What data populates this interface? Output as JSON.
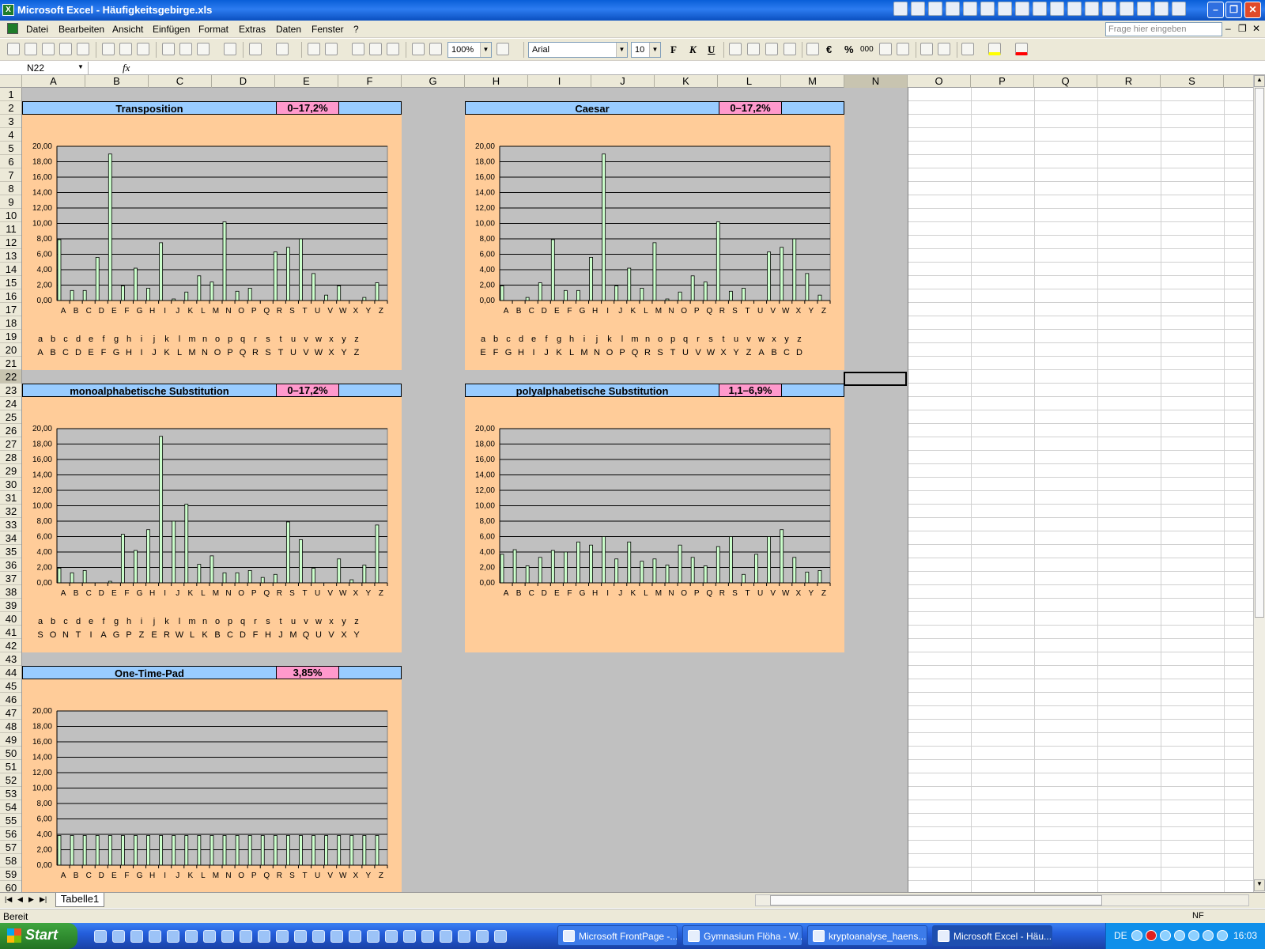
{
  "window": {
    "title": "Microsoft Excel - Häufigkeitsgebirge.xls"
  },
  "menu": [
    "Datei",
    "Bearbeiten",
    "Ansicht",
    "Einfügen",
    "Format",
    "Extras",
    "Daten",
    "Fenster",
    "?"
  ],
  "help_placeholder": "Frage hier eingeben",
  "toolbar": {
    "zoom": "100%",
    "font": "Arial",
    "size": "10",
    "bold": "F",
    "italic": "K",
    "underline": "U",
    "euro": "€",
    "percent": "%",
    "thousands": "000"
  },
  "formula": {
    "namebox": "N22",
    "fx": "fx"
  },
  "columns": [
    "A",
    "B",
    "C",
    "D",
    "E",
    "F",
    "G",
    "H",
    "I",
    "J",
    "K",
    "L",
    "M",
    "N",
    "O",
    "P",
    "Q",
    "R",
    "S"
  ],
  "rows": [
    "1",
    "2",
    "3",
    "4",
    "5",
    "6",
    "7",
    "8",
    "9",
    "10",
    "11",
    "12",
    "13",
    "14",
    "15",
    "16",
    "17",
    "18",
    "19",
    "20",
    "21",
    "22",
    "23",
    "24",
    "25",
    "26",
    "27",
    "28",
    "29",
    "30",
    "31",
    "32",
    "33",
    "34",
    "35",
    "36",
    "37",
    "38",
    "39",
    "40",
    "41",
    "42",
    "43",
    "44",
    "45",
    "46",
    "47",
    "48",
    "49",
    "50",
    "51",
    "52",
    "53",
    "54",
    "55",
    "56",
    "57",
    "58",
    "59",
    "60"
  ],
  "sections": [
    {
      "title": "Transposition",
      "range": "0–17,2%",
      "map_top": "abcdefghijklmnopqrstuvwxyz",
      "map_bottom": "ABCDEFGHIJKLMNOPQRSTUVWXYZ"
    },
    {
      "title": "Caesar",
      "range": "0–17,2%",
      "map_top": "abcdefghijklmnopqrstuvwxyz",
      "map_bottom": "EFGHIJKLMNOPQRSTUVWXYZABCD"
    },
    {
      "title": "monoalphabetische Substitution",
      "range": "0–17,2%",
      "map_top": "abcdefghijklmnopqrstuvwxyz",
      "map_bottom": "SONTIAGPZERWLKBCDFHJMQUVXY"
    },
    {
      "title": "polyalphabetische Substitution",
      "range": "1,1–6,9%",
      "map_top": "",
      "map_bottom": ""
    },
    {
      "title": "One-Time-Pad",
      "range": "3,85%",
      "map_top": "",
      "map_bottom": ""
    }
  ],
  "chart_data": [
    {
      "type": "bar",
      "title": "Transposition",
      "categories": [
        "A",
        "B",
        "C",
        "D",
        "E",
        "F",
        "G",
        "H",
        "I",
        "J",
        "K",
        "L",
        "M",
        "N",
        "O",
        "P",
        "Q",
        "R",
        "S",
        "T",
        "U",
        "V",
        "W",
        "X",
        "Y",
        "Z"
      ],
      "values": [
        7.9,
        1.3,
        1.3,
        5.6,
        19.0,
        1.9,
        4.2,
        1.6,
        7.5,
        0.2,
        1.1,
        3.2,
        2.4,
        10.2,
        1.2,
        1.6,
        0.0,
        6.3,
        6.9,
        8.0,
        3.5,
        0.7,
        1.9,
        0.0,
        0.4,
        2.3
      ],
      "ylim": [
        0,
        20
      ],
      "yticks": [
        "0,00",
        "2,00",
        "4,00",
        "6,00",
        "8,00",
        "10,00",
        "12,00",
        "14,00",
        "16,00",
        "18,00",
        "20,00"
      ],
      "grid": true
    },
    {
      "type": "bar",
      "title": "Caesar",
      "categories": [
        "A",
        "B",
        "C",
        "D",
        "E",
        "F",
        "G",
        "H",
        "I",
        "J",
        "K",
        "L",
        "M",
        "N",
        "O",
        "P",
        "Q",
        "R",
        "S",
        "T",
        "U",
        "V",
        "W",
        "X",
        "Y",
        "Z"
      ],
      "values": [
        1.9,
        0.0,
        0.4,
        2.3,
        7.9,
        1.3,
        1.3,
        5.6,
        19.0,
        1.9,
        4.2,
        1.6,
        7.5,
        0.2,
        1.1,
        3.2,
        2.4,
        10.2,
        1.2,
        1.6,
        0.0,
        6.3,
        6.9,
        8.0,
        3.5,
        0.7
      ],
      "ylim": [
        0,
        20
      ],
      "yticks": [
        "0,00",
        "2,00",
        "4,00",
        "6,00",
        "8,00",
        "10,00",
        "12,00",
        "14,00",
        "16,00",
        "18,00",
        "20,00"
      ],
      "grid": true
    },
    {
      "type": "bar",
      "title": "monoalphabetische Substitution",
      "categories": [
        "A",
        "B",
        "C",
        "D",
        "E",
        "F",
        "G",
        "H",
        "I",
        "J",
        "K",
        "L",
        "M",
        "N",
        "O",
        "P",
        "Q",
        "R",
        "S",
        "T",
        "U",
        "V",
        "W",
        "X",
        "Y",
        "Z"
      ],
      "values": [
        1.9,
        1.3,
        1.6,
        0.0,
        0.2,
        6.3,
        4.2,
        6.9,
        19.0,
        8.0,
        10.2,
        2.4,
        3.5,
        1.3,
        1.3,
        1.6,
        0.7,
        1.1,
        7.9,
        5.6,
        1.9,
        0.0,
        3.1,
        0.4,
        2.3,
        7.5
      ],
      "ylim": [
        0,
        20
      ],
      "yticks": [
        "0,00",
        "2,00",
        "4,00",
        "6,00",
        "8,00",
        "10,00",
        "12,00",
        "14,00",
        "16,00",
        "18,00",
        "20,00"
      ],
      "grid": true
    },
    {
      "type": "bar",
      "title": "polyalphabetische Substitution",
      "categories": [
        "A",
        "B",
        "C",
        "D",
        "E",
        "F",
        "G",
        "H",
        "I",
        "J",
        "K",
        "L",
        "M",
        "N",
        "O",
        "P",
        "Q",
        "R",
        "S",
        "T",
        "U",
        "V",
        "W",
        "X",
        "Y",
        "Z"
      ],
      "values": [
        3.7,
        4.3,
        2.2,
        3.3,
        4.2,
        4.0,
        5.3,
        4.9,
        6.0,
        3.1,
        5.3,
        2.8,
        3.1,
        2.3,
        4.9,
        3.3,
        2.2,
        4.7,
        6.0,
        1.1,
        3.7,
        6.0,
        6.9,
        3.3,
        1.4,
        1.6
      ],
      "ylim": [
        0,
        20
      ],
      "yticks": [
        "0,00",
        "2,00",
        "4,00",
        "6,00",
        "8,00",
        "10,00",
        "12,00",
        "14,00",
        "16,00",
        "18,00",
        "20,00"
      ],
      "grid": true
    },
    {
      "type": "bar",
      "title": "One-Time-Pad",
      "categories": [
        "A",
        "B",
        "C",
        "D",
        "E",
        "F",
        "G",
        "H",
        "I",
        "J",
        "K",
        "L",
        "M",
        "N",
        "O",
        "P",
        "Q",
        "R",
        "S",
        "T",
        "U",
        "V",
        "W",
        "X",
        "Y",
        "Z"
      ],
      "values": [
        3.85,
        3.85,
        3.85,
        3.85,
        3.85,
        3.85,
        3.85,
        3.85,
        3.85,
        3.85,
        3.85,
        3.85,
        3.85,
        3.85,
        3.85,
        3.85,
        3.85,
        3.85,
        3.85,
        3.85,
        3.85,
        3.85,
        3.85,
        3.85,
        3.85,
        3.85
      ],
      "ylim": [
        0,
        20
      ],
      "yticks": [
        "0,00",
        "2,00",
        "4,00",
        "6,00",
        "8,00",
        "10,00",
        "12,00",
        "14,00",
        "16,00",
        "18,00",
        "20,00"
      ],
      "grid": true
    }
  ],
  "sheet_tab": "Tabelle1",
  "status": {
    "left": "Bereit",
    "right": "NF"
  },
  "taskbar": {
    "start": "Start",
    "tasks": [
      "Microsoft FrontPage -...",
      "Gymnasium Flöha - W...",
      "kryptoanalyse_haens...",
      "Microsoft Excel - Häu..."
    ],
    "lang": "DE",
    "clock": "16:03"
  },
  "colors": {
    "header_blue": "#99ccff",
    "range_pink": "#ff99cc",
    "panel_peach": "#ffcc99",
    "plot_gray": "#c0c0c0",
    "bar_green": "#ccffcc"
  }
}
